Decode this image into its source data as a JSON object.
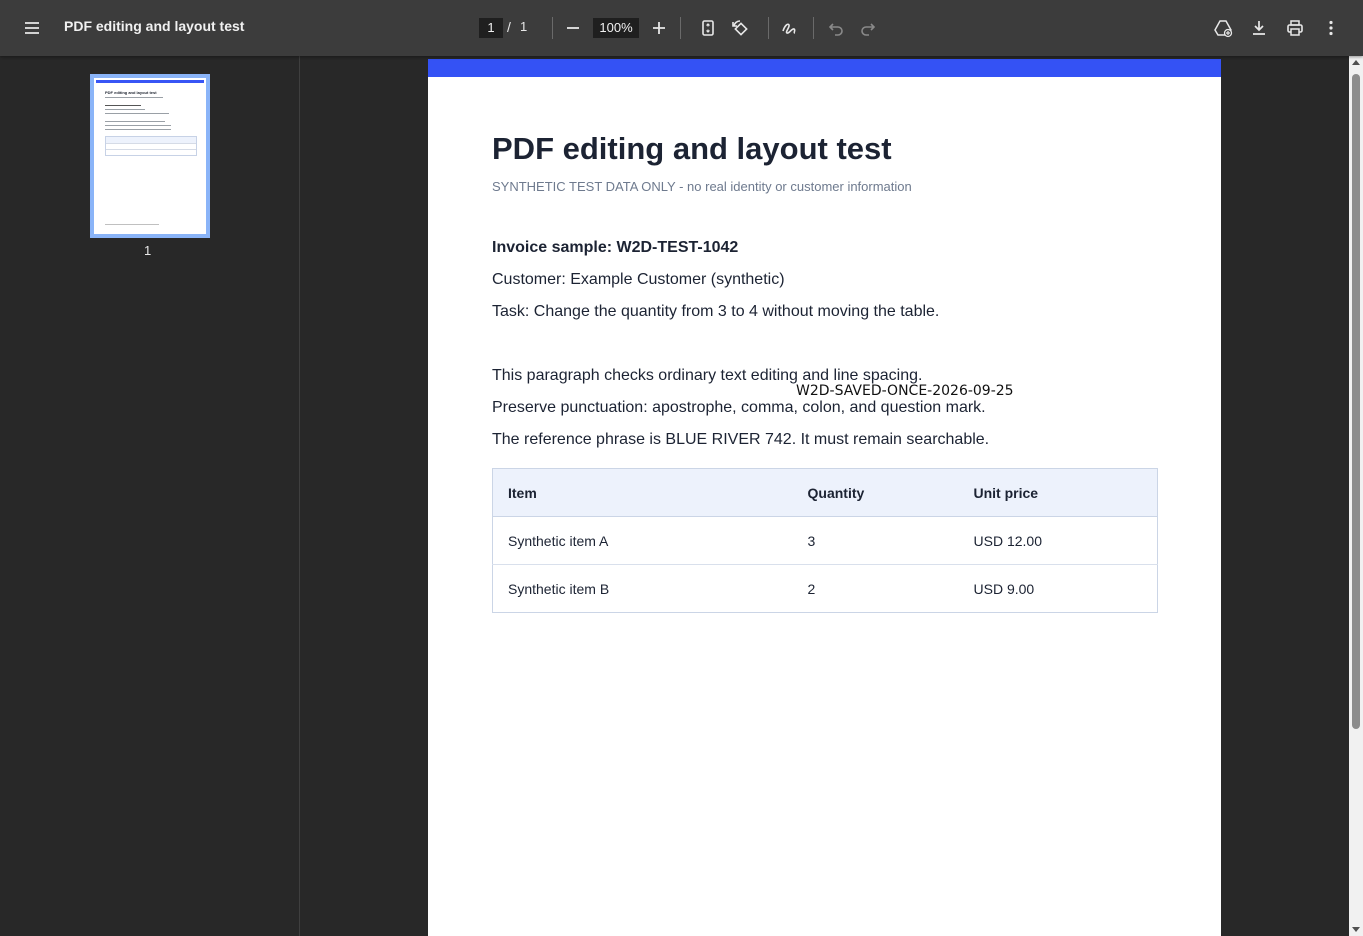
{
  "toolbar": {
    "title": "PDF editing and layout test",
    "page_current": "1",
    "page_separator": "/",
    "page_total": "1",
    "zoom": "100%"
  },
  "sidebar": {
    "thumbnail_title": "PDF editing and layout test",
    "thumbnail_label": "1"
  },
  "document": {
    "title": "PDF editing and layout test",
    "subtitle": "SYNTHETIC TEST DATA ONLY - no real identity or customer information",
    "invoice_heading": "Invoice sample: W2D-TEST-1042",
    "customer": "Customer: Example Customer (synthetic)",
    "task": "Task: Change the quantity from 3 to 4 without moving the table.",
    "paragraph_1": "This paragraph checks ordinary text editing and line spacing.",
    "paragraph_2": "Preserve punctuation: apostrophe, comma, colon, and question mark.",
    "paragraph_3": "The reference phrase is BLUE RIVER 742. It must remain searchable.",
    "stamp": "W2D-SAVED-ONCE-2026-09-25",
    "table": {
      "headers": [
        "Item",
        "Quantity",
        "Unit price"
      ],
      "rows": [
        [
          "Synthetic item A",
          "3",
          "USD 12.00"
        ],
        [
          "Synthetic item B",
          "2",
          "USD 9.00"
        ]
      ]
    }
  },
  "colors": {
    "accent_bar": "#3452f5",
    "thumbnail_border": "#8ab4f8",
    "toolbar_bg": "#3c3c3c"
  },
  "icons": {
    "menu": "menu-icon",
    "zoom_out": "minus-icon",
    "zoom_in": "plus-icon",
    "fit_page": "fit-to-page-icon",
    "rotate": "rotate-icon",
    "annotate": "draw-icon",
    "undo": "undo-icon",
    "redo": "redo-icon",
    "drive": "drive-add-icon",
    "download": "download-icon",
    "print": "print-icon",
    "more": "more-vert-icon"
  }
}
